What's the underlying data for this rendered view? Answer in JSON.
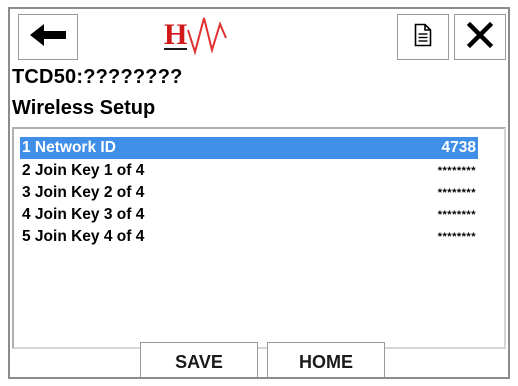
{
  "header": {
    "back_icon": "arrow-left-icon",
    "logo_icon": "hw-brand-logo",
    "logo_letter": "H",
    "logo_colors": {
      "letter": "#d01818",
      "wave": "#e03030",
      "underline": "#1a1a1a"
    },
    "doc_icon": "document-icon",
    "close_icon": "close-icon"
  },
  "device_tag": "TCD50:????????",
  "page_title": "Wireless Setup",
  "list": {
    "selected_color": "#3f8ee8",
    "items": [
      {
        "label": "1 Network ID",
        "value": "4738"
      },
      {
        "label": "2 Join Key 1 of 4",
        "value": "********"
      },
      {
        "label": "3 Join Key 2 of 4",
        "value": "********"
      },
      {
        "label": "4 Join Key 3 of 4",
        "value": "********"
      },
      {
        "label": "5 Join Key 4 of 4",
        "value": "********"
      }
    ]
  },
  "buttons": {
    "save_label": "SAVE",
    "home_label": "HOME"
  }
}
